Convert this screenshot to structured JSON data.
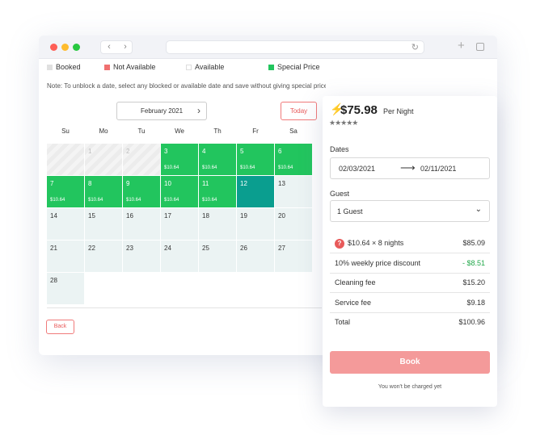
{
  "legend": [
    {
      "label": "Booked",
      "color": "#e0e0e0"
    },
    {
      "label": "Not Available",
      "color": "#f07070"
    },
    {
      "label": "Available",
      "color": "#ffffff"
    },
    {
      "label": "Special Price",
      "color": "#22c55e"
    }
  ],
  "note": "Note: To unblock a date, select any blocked or available date and save without giving special price",
  "calendar": {
    "month": "February 2021",
    "today_label": "Today",
    "weekdays": [
      "Su",
      "Mo",
      "Tu",
      "We",
      "Th",
      "Fr",
      "Sa"
    ],
    "days": [
      {
        "n": "",
        "state": "past"
      },
      {
        "n": "1",
        "state": "past"
      },
      {
        "n": "2",
        "state": "past"
      },
      {
        "n": "3",
        "state": "special",
        "price": "$10.64"
      },
      {
        "n": "4",
        "state": "special",
        "price": "$10.64"
      },
      {
        "n": "5",
        "state": "special",
        "price": "$10.64"
      },
      {
        "n": "6",
        "state": "special",
        "price": "$10.64"
      },
      {
        "n": "7",
        "state": "special",
        "price": "$10.64"
      },
      {
        "n": "8",
        "state": "special",
        "price": "$10.64"
      },
      {
        "n": "9",
        "state": "special",
        "price": "$10.64"
      },
      {
        "n": "10",
        "state": "special",
        "price": "$10.64"
      },
      {
        "n": "11",
        "state": "special",
        "price": "$10.64"
      },
      {
        "n": "12",
        "state": "selected"
      },
      {
        "n": "13",
        "state": "avail"
      },
      {
        "n": "14",
        "state": "avail"
      },
      {
        "n": "15",
        "state": "avail"
      },
      {
        "n": "16",
        "state": "avail"
      },
      {
        "n": "17",
        "state": "avail"
      },
      {
        "n": "18",
        "state": "avail"
      },
      {
        "n": "19",
        "state": "avail"
      },
      {
        "n": "20",
        "state": "avail"
      },
      {
        "n": "21",
        "state": "avail"
      },
      {
        "n": "22",
        "state": "avail"
      },
      {
        "n": "23",
        "state": "avail"
      },
      {
        "n": "24",
        "state": "avail"
      },
      {
        "n": "25",
        "state": "avail"
      },
      {
        "n": "26",
        "state": "avail"
      },
      {
        "n": "27",
        "state": "avail"
      },
      {
        "n": "28",
        "state": "avail"
      }
    ],
    "back_label": "Back"
  },
  "booking": {
    "price": "$75.98",
    "per_night": "Per Night",
    "stars": "★★★★★",
    "dates_label": "Dates",
    "check_in": "02/03/2021",
    "check_out": "02/11/2021",
    "guest_label": "Guest",
    "guest_value": "1 Guest",
    "breakdown": [
      {
        "label": "$10.64 × 8 nights",
        "value": "$85.09",
        "icon": "question-icon"
      },
      {
        "label": "10% weekly price discount",
        "value": "- $8.51",
        "discount": true
      },
      {
        "label": "Cleaning fee",
        "value": "$15.20"
      },
      {
        "label": "Service fee",
        "value": "$9.18"
      },
      {
        "label": "Total",
        "value": "$100.96"
      }
    ],
    "book_label": "Book",
    "no_charge": "You won't be charged yet"
  }
}
